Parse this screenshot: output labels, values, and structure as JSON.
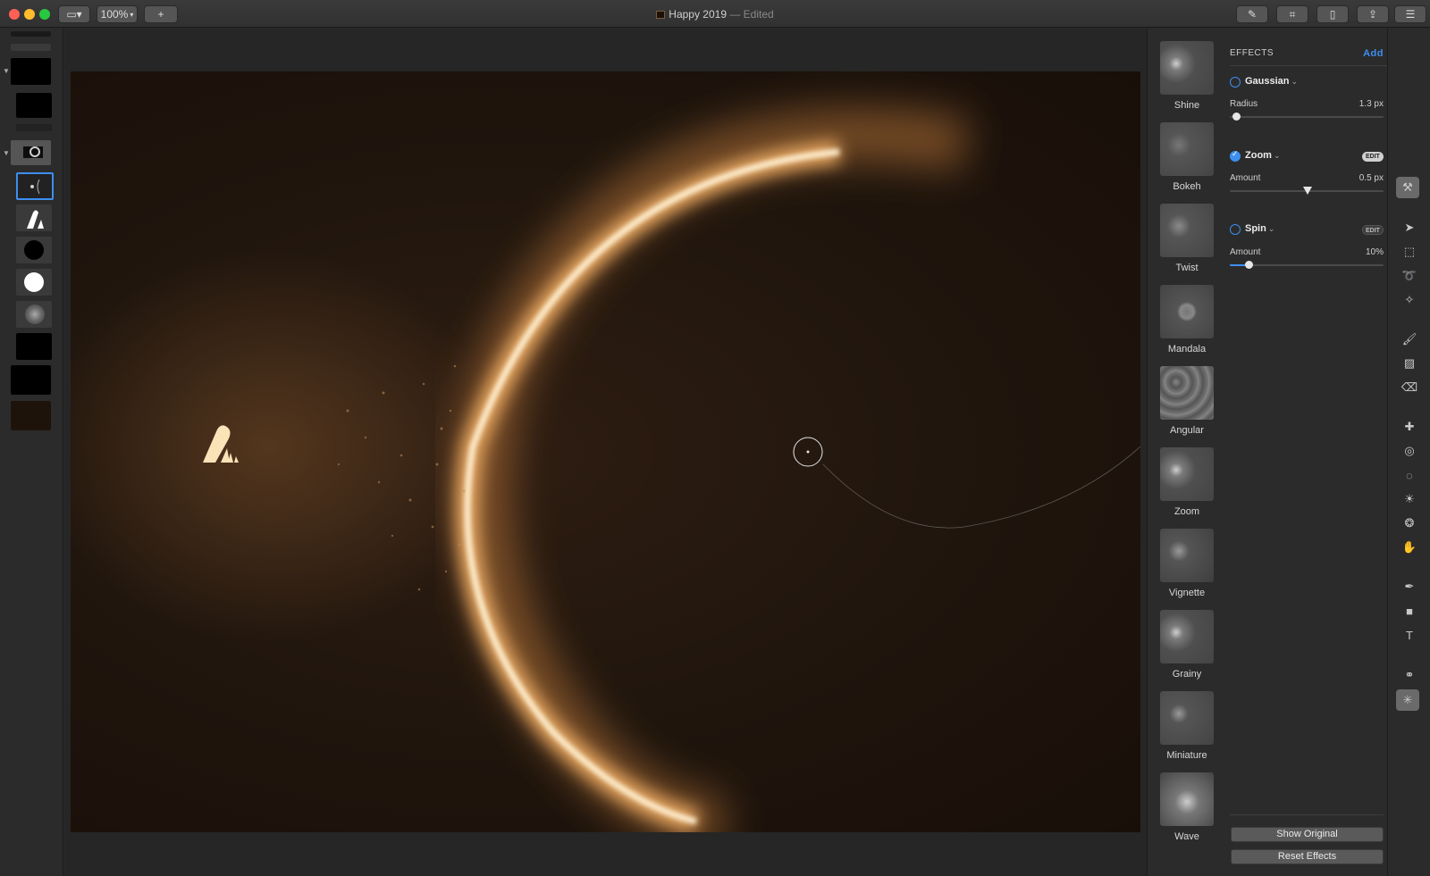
{
  "window": {
    "title": "Happy 2019",
    "title_suffix": "— Edited",
    "zoom": "100%"
  },
  "effects": {
    "header": "EFFECTS",
    "add_label": "Add",
    "items": [
      {
        "name": "Gaussian",
        "param_label": "Radius",
        "value": "1.3 px",
        "enabled": false,
        "level": 0.04
      },
      {
        "name": "Zoom",
        "param_label": "Amount",
        "value": "0.5 px",
        "enabled": true,
        "level": 0.5,
        "edit_label": "EDIT"
      },
      {
        "name": "Spin",
        "param_label": "Amount",
        "value": "10%",
        "enabled": false,
        "level": 0.12,
        "edit_label": "EDIT"
      }
    ],
    "show_original": "Show Original",
    "reset_effects": "Reset Effects"
  },
  "presets": [
    "Shine",
    "Bokeh",
    "Twist",
    "Mandala",
    "Angular",
    "Zoom",
    "Vignette",
    "Grainy",
    "Miniature",
    "Wave"
  ],
  "colors": {
    "accent": "#3d8ef0",
    "glow": "#f6c98a"
  }
}
